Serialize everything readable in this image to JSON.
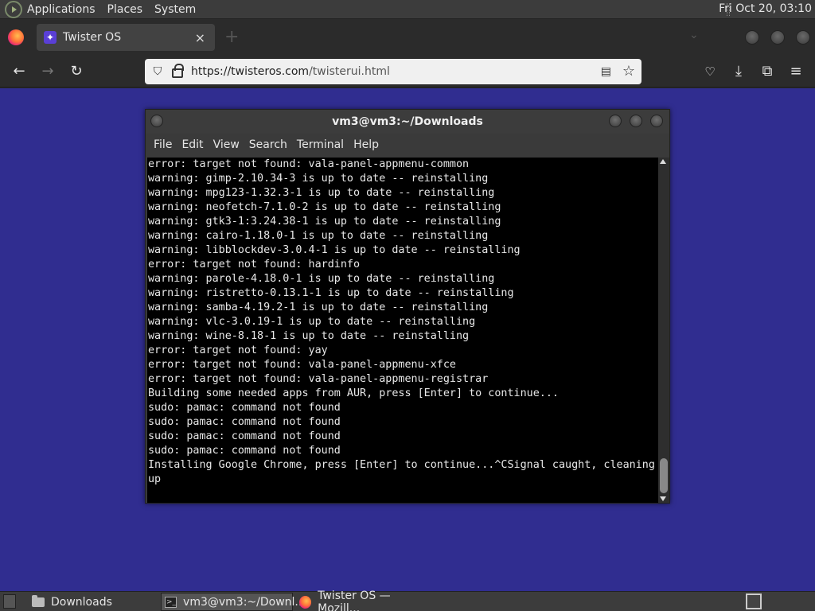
{
  "top_panel": {
    "menus": [
      "Applications",
      "Places",
      "System"
    ],
    "clock": "Fri Oct 20, 03:10"
  },
  "browser": {
    "tab_title": "Twister OS",
    "tab_close": "×",
    "new_tab": "+",
    "url_host": "https://twisteros.com",
    "url_path": "/twisterui.html"
  },
  "terminal": {
    "title": "vm3@vm3:~/Downloads",
    "menu": [
      "File",
      "Edit",
      "View",
      "Search",
      "Terminal",
      "Help"
    ],
    "lines": [
      "error: target not found: vala-panel-appmenu-common",
      "warning: gimp-2.10.34-3 is up to date -- reinstalling",
      "warning: mpg123-1.32.3-1 is up to date -- reinstalling",
      "warning: neofetch-7.1.0-2 is up to date -- reinstalling",
      "warning: gtk3-1:3.24.38-1 is up to date -- reinstalling",
      "warning: cairo-1.18.0-1 is up to date -- reinstalling",
      "warning: libblockdev-3.0.4-1 is up to date -- reinstalling",
      "error: target not found: hardinfo",
      "warning: parole-4.18.0-1 is up to date -- reinstalling",
      "warning: ristretto-0.13.1-1 is up to date -- reinstalling",
      "warning: samba-4.19.2-1 is up to date -- reinstalling",
      "warning: vlc-3.0.19-1 is up to date -- reinstalling",
      "warning: wine-8.18-1 is up to date -- reinstalling",
      "error: target not found: yay",
      "error: target not found: vala-panel-appmenu-xfce",
      "error: target not found: vala-panel-appmenu-registrar",
      "Building some needed apps from AUR, press [Enter] to continue...",
      "sudo: pamac: command not found",
      "sudo: pamac: command not found",
      "sudo: pamac: command not found",
      "sudo: pamac: command not found",
      "Installing Google Chrome, press [Enter] to continue...^CSignal caught, cleaning",
      "up"
    ]
  },
  "taskbar": {
    "tasks": [
      {
        "label": "Downloads",
        "icon": "folder-icon"
      },
      {
        "label": "vm3@vm3:~/Downl...",
        "icon": "terminal-icon"
      },
      {
        "label": "Twister OS — Mozill...",
        "icon": "firefox-icon"
      }
    ]
  },
  "colors": {
    "desktop_bg": "#302d90",
    "terminal_bg": "#000000",
    "panel_bg": "#3c3c3c"
  }
}
